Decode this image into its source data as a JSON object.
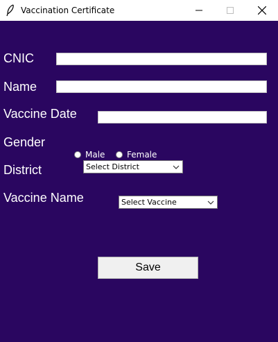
{
  "window": {
    "title": "Vaccination Certificate",
    "icon": "feather-icon"
  },
  "form": {
    "cnic": {
      "label": "CNIC",
      "value": ""
    },
    "name": {
      "label": "Name",
      "value": ""
    },
    "vaccine_date": {
      "label": "Vaccine Date",
      "value": ""
    },
    "gender": {
      "label": "Gender",
      "options": [
        "Male",
        "Female"
      ],
      "selected": null
    },
    "district": {
      "label": "District",
      "selected": "Select District"
    },
    "vaccine_name": {
      "label": "Vaccine Name",
      "selected": "Select Vaccine"
    },
    "save_label": "Save"
  },
  "colors": {
    "background": "#2a0660",
    "label_text": "#ffffff",
    "button_face": "#f0f0f0"
  }
}
